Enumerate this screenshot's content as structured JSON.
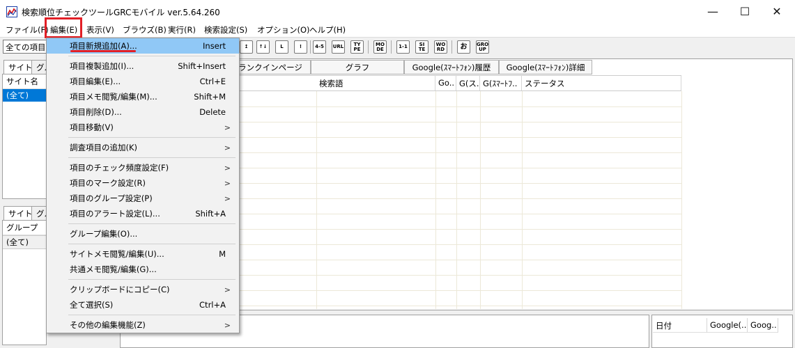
{
  "window": {
    "title": "検索順位チェックツールGRCモバイル  ver.5.64.260",
    "minimize_glyph": "—",
    "maximize_glyph": "☐",
    "close_glyph": "✕"
  },
  "menubar": {
    "items": [
      "ファイル(F)",
      "編集(E)",
      "表示(V)",
      "ブラウズ(B)",
      "実行(R)",
      "検索設定(S)",
      "オプション(O)",
      "ヘルプ(H)"
    ]
  },
  "toolbar": {
    "combo_value": "全ての項目",
    "buttons": [
      "↥",
      "↑↓",
      "L",
      "!",
      "4-5",
      "URL",
      "TY PE",
      "MO DE",
      "1-1",
      "SI TE",
      "WO RD",
      "お",
      "GRO UP"
    ]
  },
  "left_top_panel": {
    "tabs": [
      "サイト",
      "グル"
    ],
    "header": "サイト名",
    "selected_row": "(全て)"
  },
  "left_bottom_panel": {
    "tabs": [
      "サイト",
      "グル"
    ],
    "header": "グループ",
    "selected_row": "(全て)"
  },
  "main": {
    "column_tabs": [
      "ランクインページ",
      "グラフ",
      "Google(ｽﾏｰﾄﾌｫﾝ)履歴",
      "Google(ｽﾏｰﾄﾌｫﾝ)詳細"
    ],
    "headers": [
      "検索語",
      "Go..",
      "G(ス..",
      "G(ｽﾏｰﾄﾌ..",
      "ステータス"
    ]
  },
  "right_bottom_panel": {
    "headers": [
      "日付",
      "Google(..",
      "Goog.."
    ]
  },
  "edit_menu": {
    "items": [
      {
        "label": "項目新規追加(A)...",
        "shortcut": "Insert",
        "submenu": false,
        "highlighted": true
      },
      {
        "label": "項目複製追加(I)...",
        "shortcut": "Shift+Insert",
        "submenu": false
      },
      {
        "label": "項目編集(E)...",
        "shortcut": "Ctrl+E",
        "submenu": false
      },
      {
        "label": "項目メモ閲覧/編集(M)...",
        "shortcut": "Shift+M",
        "submenu": false
      },
      {
        "label": "項目削除(D)...",
        "shortcut": "Delete",
        "submenu": false
      },
      {
        "label": "項目移動(V)",
        "shortcut": "",
        "submenu": true
      },
      {
        "label": "調査項目の追加(K)",
        "shortcut": "",
        "submenu": true
      },
      {
        "label": "項目のチェック頻度設定(F)",
        "shortcut": "",
        "submenu": true
      },
      {
        "label": "項目のマーク設定(R)",
        "shortcut": "",
        "submenu": true
      },
      {
        "label": "項目のグループ設定(P)",
        "shortcut": "",
        "submenu": true
      },
      {
        "label": "項目のアラート設定(L)...",
        "shortcut": "Shift+A",
        "submenu": false
      },
      {
        "label": "グループ編集(O)...",
        "shortcut": "",
        "submenu": false
      },
      {
        "label": "サイトメモ閲覧/編集(U)...",
        "shortcut": "M",
        "submenu": false
      },
      {
        "label": "共通メモ閲覧/編集(G)...",
        "shortcut": "",
        "submenu": false
      },
      {
        "label": "クリップボードにコピー(C)",
        "shortcut": "",
        "submenu": true
      },
      {
        "label": "全て選択(S)",
        "shortcut": "Ctrl+A",
        "submenu": false
      },
      {
        "label": "その他の編集機能(Z)",
        "shortcut": "",
        "submenu": true
      }
    ],
    "submenu_arrow": ">"
  },
  "colors": {
    "highlight_red": "#e21f26",
    "selection_blue": "#0078d7",
    "menu_hover": "#90c8f6"
  }
}
